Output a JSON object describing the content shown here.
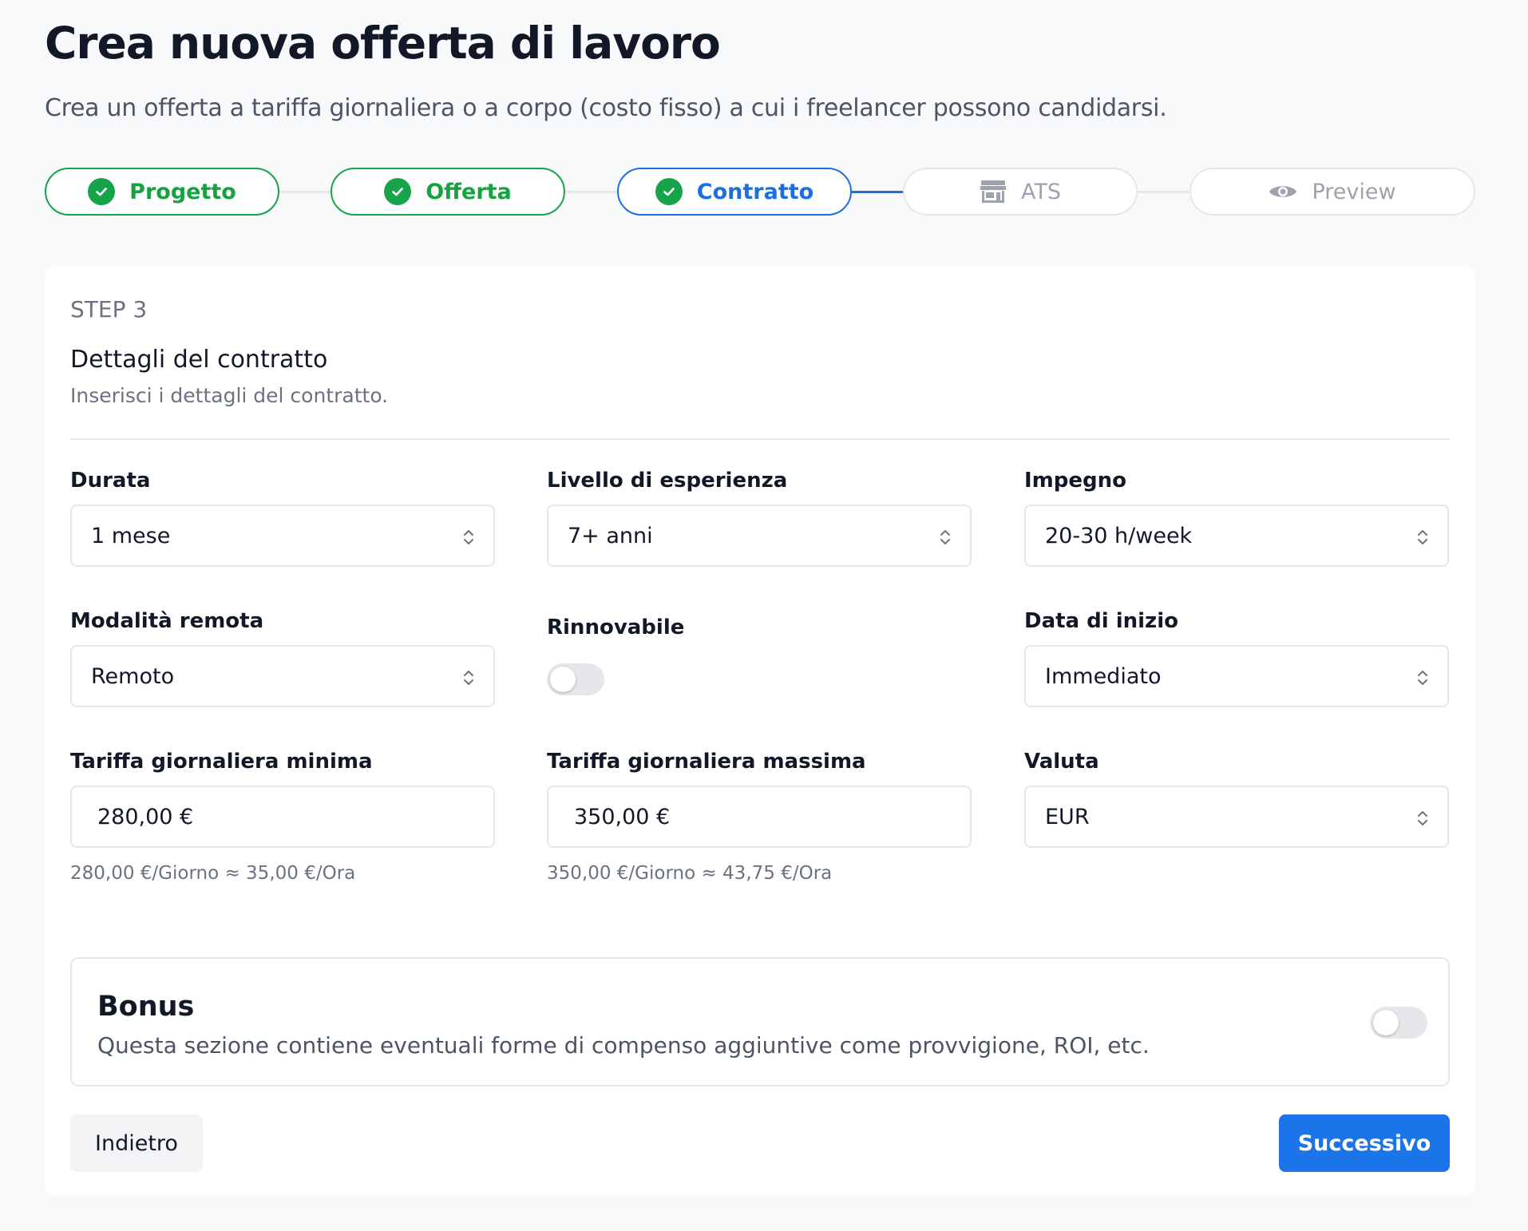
{
  "header": {
    "title": "Crea nuova offerta di lavoro",
    "subtitle": "Crea un offerta a tariffa giornaliera o a corpo (costo fisso) a cui i freelancer possono candidarsi."
  },
  "stepper": {
    "steps": [
      {
        "label": "Progetto",
        "state": "done"
      },
      {
        "label": "Offerta",
        "state": "done"
      },
      {
        "label": "Contratto",
        "state": "current"
      },
      {
        "label": "ATS",
        "state": "future",
        "icon": "store-icon"
      },
      {
        "label": "Preview",
        "state": "future",
        "icon": "eye-icon"
      }
    ]
  },
  "form": {
    "step_label": "STEP 3",
    "section_title": "Dettagli del contratto",
    "section_description": "Inserisci i dettagli del contratto.",
    "durata": {
      "label": "Durata",
      "value": "1 mese"
    },
    "esperienza": {
      "label": "Livello di esperienza",
      "value": "7+ anni"
    },
    "impegno": {
      "label": "Impegno",
      "value": "20-30 h/week"
    },
    "remota": {
      "label": "Modalità remota",
      "value": "Remoto"
    },
    "rinnovabile": {
      "label": "Rinnovabile",
      "enabled": false
    },
    "data_inizio": {
      "label": "Data di inizio",
      "value": "Immediato"
    },
    "tariffa_min": {
      "label": "Tariffa giornaliera minima",
      "value": "280,00 €",
      "hint": "280,00 €/Giorno ≈ 35,00 €/Ora"
    },
    "tariffa_max": {
      "label": "Tariffa giornaliera massima",
      "value": "350,00 €",
      "hint": "350,00 €/Giorno ≈ 43,75 €/Ora"
    },
    "valuta": {
      "label": "Valuta",
      "value": "EUR"
    }
  },
  "bonus": {
    "title": "Bonus",
    "description": "Questa sezione contiene eventuali forme di compenso aggiuntive come provvigione, ROI, etc.",
    "enabled": false
  },
  "actions": {
    "back_label": "Indietro",
    "next_label": "Successivo"
  },
  "colors": {
    "done": "#16a34a",
    "current": "#1b6fe3",
    "primary_button": "#1b74e8",
    "page_background": "#f8f9fb"
  }
}
